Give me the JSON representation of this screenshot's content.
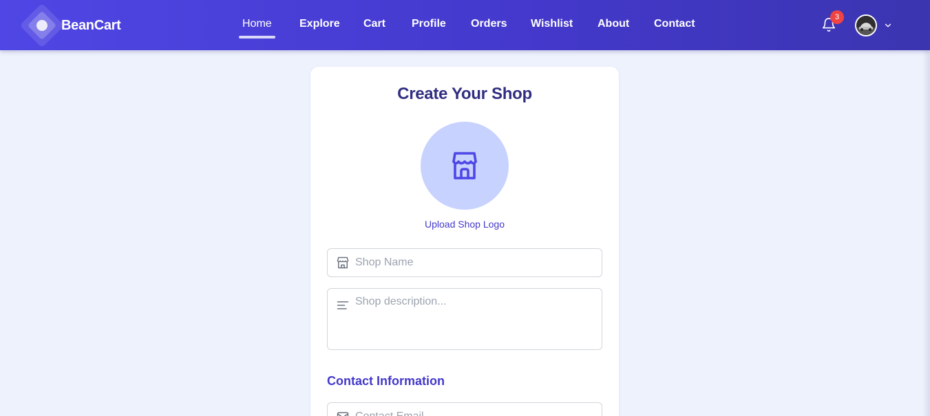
{
  "brand": {
    "name": "BeanCart"
  },
  "nav": {
    "items": [
      {
        "label": "Home",
        "active": true
      },
      {
        "label": "Explore"
      },
      {
        "label": "Cart"
      },
      {
        "label": "Profile"
      },
      {
        "label": "Orders"
      },
      {
        "label": "Wishlist"
      },
      {
        "label": "About"
      },
      {
        "label": "Contact"
      }
    ],
    "notifications_count": "3"
  },
  "form": {
    "title": "Create Your Shop",
    "upload_logo_label": "Upload Shop Logo",
    "shop_name_placeholder": "Shop Name",
    "shop_description_placeholder": "Shop description...",
    "contact_heading": "Contact Information",
    "contact_email_placeholder": "Contact Email"
  },
  "colors": {
    "nav_gradient_start": "#4f46e5",
    "nav_gradient_end": "#3b35b0",
    "title": "#312e81",
    "accent": "#4338ca",
    "logo_circle": "#c7d2fe",
    "badge": "#ef4444",
    "page_background": "#eef2fd"
  },
  "icons": {
    "nav_bell": "bell-icon",
    "avatar_chevron": "chevron-down-icon",
    "logo_upload": "store-icon",
    "shop_name": "store-icon",
    "description": "align-left-icon",
    "email": "mail-icon"
  }
}
